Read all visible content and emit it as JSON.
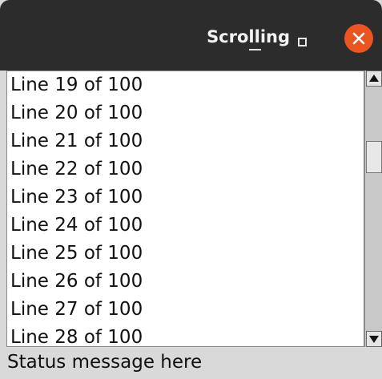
{
  "window": {
    "title": "Scrolling"
  },
  "icons": {
    "minimize": "minimize-icon",
    "maximize": "maximize-icon",
    "close": "close-icon",
    "scroll_up": "triangle-up-icon",
    "scroll_down": "triangle-down-icon"
  },
  "colors": {
    "titlebar": "#2c2c2c",
    "close_button": "#e9541f",
    "background": "#d9d9d9"
  },
  "list": {
    "items": [
      "Line 19 of 100",
      "Line 20 of 100",
      "Line 21 of 100",
      "Line 22 of 100",
      "Line 23 of 100",
      "Line 24 of 100",
      "Line 25 of 100",
      "Line 26 of 100",
      "Line 27 of 100",
      "Line 28 of 100"
    ]
  },
  "scrollbar": {
    "position_fraction": 0.18
  },
  "status": {
    "text": "Status message here"
  }
}
